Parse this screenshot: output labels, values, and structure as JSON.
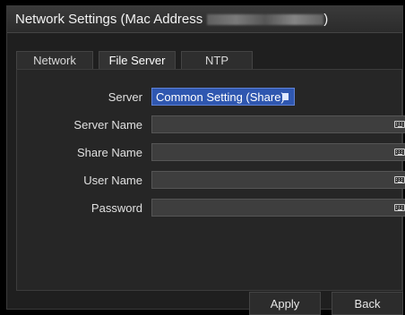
{
  "window": {
    "title_prefix": "Network Settings (Mac Address",
    "title_suffix": ")"
  },
  "tabs": [
    {
      "label": "Network",
      "active": false
    },
    {
      "label": "File Server",
      "active": true
    },
    {
      "label": "NTP",
      "active": false
    }
  ],
  "form": {
    "server": {
      "label": "Server",
      "value": "Common Setting (Share)",
      "icon": "dropdown-icon"
    },
    "server_name": {
      "label": "Server Name",
      "value": "",
      "icon": "keyboard-icon"
    },
    "share_name": {
      "label": "Share Name",
      "value": "",
      "icon": "keyboard-icon"
    },
    "user_name": {
      "label": "User Name",
      "value": "",
      "icon": "keyboard-icon"
    },
    "password": {
      "label": "Password",
      "value": "",
      "icon": "keyboard-icon"
    }
  },
  "buttons": {
    "apply": "Apply",
    "back": "Back"
  },
  "colors": {
    "select_bg": "#2f57b0",
    "field_bg": "#3e3e3e",
    "window_bg": "#1f1f1f"
  }
}
